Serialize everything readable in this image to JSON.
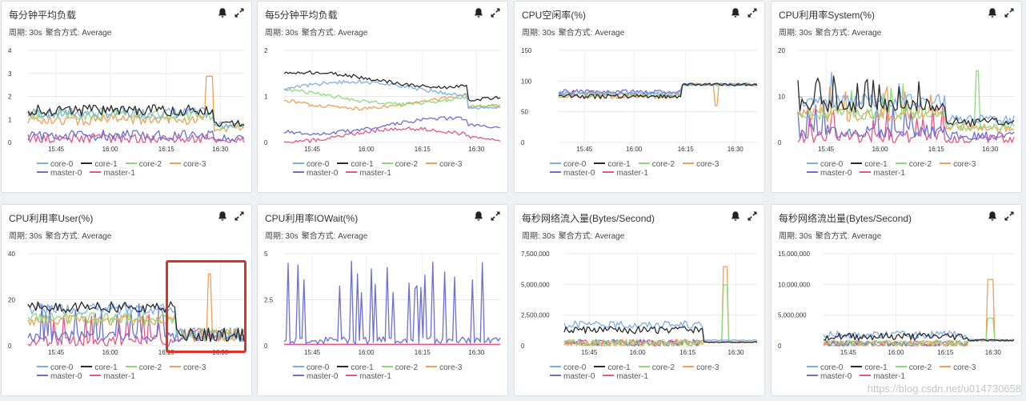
{
  "legend_labels": [
    "core-0",
    "core-1",
    "core-2",
    "core-3",
    "master-0",
    "master-1"
  ],
  "series_colors": [
    "#7eaee6",
    "#2b2b2b",
    "#8fd97c",
    "#eea157",
    "#6b6fd6",
    "#e0588a"
  ],
  "x_ticks": [
    "15:45",
    "16:00",
    "16:15",
    "16:30"
  ],
  "meta": {
    "period_label": "周期: 30s",
    "agg_label": "聚合方式: Average"
  },
  "panels": [
    {
      "title": "每分钟平均负载",
      "yticks": [
        "4",
        "3",
        "2",
        "1",
        "0"
      ]
    },
    {
      "title": "每5分钟平均负载",
      "yticks": [
        "2",
        "1",
        "0"
      ]
    },
    {
      "title": "CPU空闲率(%)",
      "yticks": [
        "150",
        "100",
        "50",
        "0"
      ]
    },
    {
      "title": "CPU利用率System(%)",
      "yticks": [
        "20",
        "10",
        "0"
      ]
    },
    {
      "title": "CPU利用率User(%)",
      "yticks": [
        "40",
        "20",
        "0"
      ]
    },
    {
      "title": "CPU利用率IOWait(%)",
      "yticks": [
        "5",
        "2.5",
        "0"
      ]
    },
    {
      "title": "每秒网络流入量(Bytes/Second)",
      "yticks": [
        "7,500,000",
        "5,000,000",
        "2,500,000",
        "0"
      ]
    },
    {
      "title": "每秒网络流出量(Bytes/Second)",
      "yticks": [
        "15,000,000",
        "10,000,000",
        "5,000,000",
        "0"
      ]
    }
  ],
  "icons": {
    "alert": "bell-icon",
    "expand": "expand-icon"
  },
  "highlight_color": "#d9342b",
  "watermark": "https://blog.csdn.net/u014730658"
}
